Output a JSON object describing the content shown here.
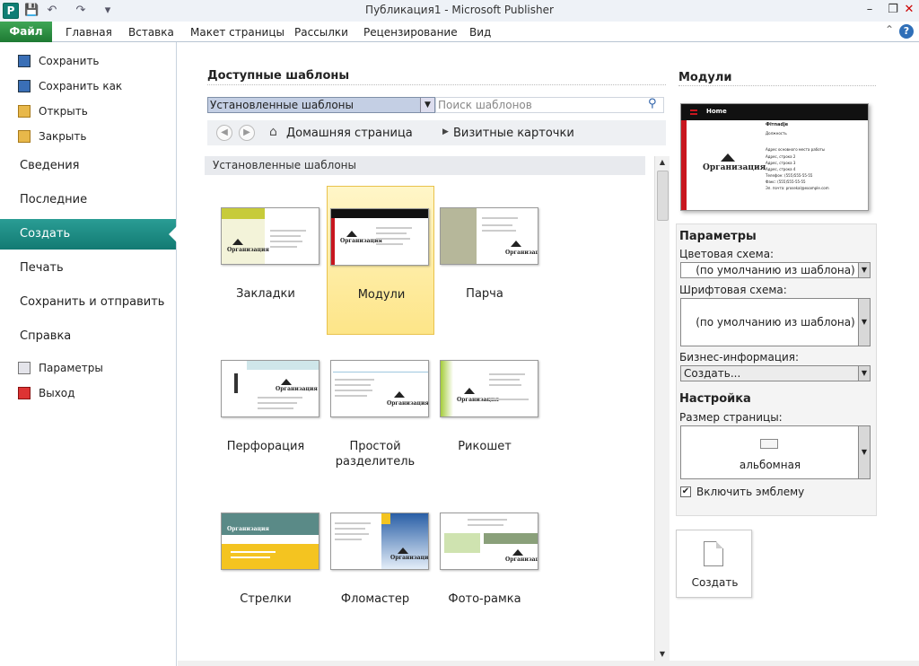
{
  "window": {
    "title": "Публикация1  -  Microsoft Publisher",
    "app_icon": "P"
  },
  "qat": {
    "save_icon": "save-icon",
    "undo_icon": "undo-icon",
    "redo_icon": "redo-icon",
    "more": "▾"
  },
  "ribbon": {
    "file": "Файл",
    "tabs": [
      "Главная",
      "Вставка",
      "Макет страницы",
      "Рассылки",
      "Рецензирование",
      "Вид"
    ]
  },
  "sidebar": {
    "save": "Сохранить",
    "save_as": "Сохранить как",
    "open": "Открыть",
    "close": "Закрыть",
    "info": "Сведения",
    "recent": "Последние",
    "create": "Создать",
    "print": "Печать",
    "save_send": "Сохранить и отправить",
    "help": "Справка",
    "options": "Параметры",
    "exit": "Выход"
  },
  "main": {
    "heading": "Доступные шаблоны",
    "source_select": "Установленные шаблоны",
    "search_placeholder": "Поиск шаблонов",
    "breadcrumb": {
      "home": "Домашняя страница",
      "current": "Визитные карточки"
    },
    "section": "Установленные шаблоны",
    "templates": [
      {
        "label": "Закладки",
        "selected": false
      },
      {
        "label": "Модули",
        "selected": true
      },
      {
        "label": "Парча",
        "selected": false
      },
      {
        "label": "Перфорация",
        "selected": false
      },
      {
        "label": "Простой разделитель",
        "selected": false
      },
      {
        "label": "Рикошет",
        "selected": false
      },
      {
        "label": "Стрелки",
        "selected": false
      },
      {
        "label": "Фломастер",
        "selected": false
      },
      {
        "label": "Фото-рамка",
        "selected": false
      }
    ]
  },
  "right": {
    "title": "Модули",
    "preview": {
      "home": "Home",
      "name": "Фiтnadje",
      "role": "Должность",
      "org": "Организация",
      "lines": [
        "Адрес основного места работы",
        "Адрес, строка 2",
        "Адрес, строка 3",
        "Адрес, строка 4",
        "Телефон: (555)555-55-55",
        "Факс: (555)555-55-55",
        "Эл. почта: prosekal@example.com"
      ]
    },
    "params_heading": "Параметры",
    "color_label": "Цветовая схема:",
    "color_value": "(по умолчанию из шаблона)",
    "font_label": "Шрифтовая схема:",
    "font_value": "(по умолчанию из шаблона)",
    "biz_label": "Бизнес-информация:",
    "biz_value": "Создать...",
    "custom_heading": "Настройка",
    "page_size_label": "Размер страницы:",
    "page_size_value": "альбомная",
    "logo_label": "Включить эмблему",
    "logo_checked": true,
    "create_button": "Создать"
  }
}
